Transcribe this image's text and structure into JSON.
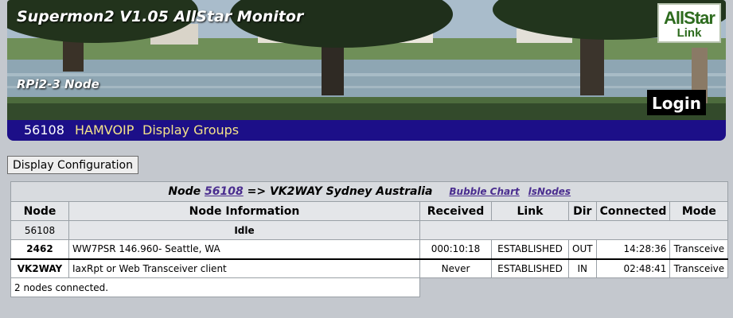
{
  "header": {
    "title": "Supermon2 V1.05 AllStar Monitor",
    "subtitle": "RPi2-3 Node",
    "logo": {
      "line1": "AllStar",
      "line2": "Link"
    },
    "login_label": "Login"
  },
  "nav": {
    "node_number": "56108",
    "items": [
      {
        "label": "HAMVOIP"
      },
      {
        "label": "Display Groups"
      }
    ]
  },
  "config_button_label": "Display Configuration",
  "node_table": {
    "title_prefix": "Node",
    "node_link": "56108",
    "title_suffix": "=> VK2WAY Sydney Australia",
    "bubble_chart": "Bubble Chart",
    "isnodes": "lsNodes",
    "columns": [
      "Node",
      "Node Information",
      "Received",
      "Link",
      "Dir",
      "Connected",
      "Mode"
    ],
    "local": {
      "node": "56108",
      "status": "Idle"
    },
    "rows": [
      {
        "node": "2462",
        "info": "WW7PSR 146.960- Seattle, WA",
        "received": "000:10:18",
        "link": "ESTABLISHED",
        "dir": "OUT",
        "connected": "14:28:36",
        "mode": "Transceive"
      },
      {
        "node": "VK2WAY",
        "info": "IaxRpt or Web Transceiver client",
        "received": "Never",
        "link": "ESTABLISHED",
        "dir": "IN",
        "connected": "02:48:41",
        "mode": "Transceive"
      }
    ],
    "footer": "2 nodes connected."
  },
  "colors": {
    "nav_background": "#1c0f88",
    "nav_link": "#f4e38a",
    "link": "#4a2d8f",
    "page_background": "#c4c8ce"
  }
}
